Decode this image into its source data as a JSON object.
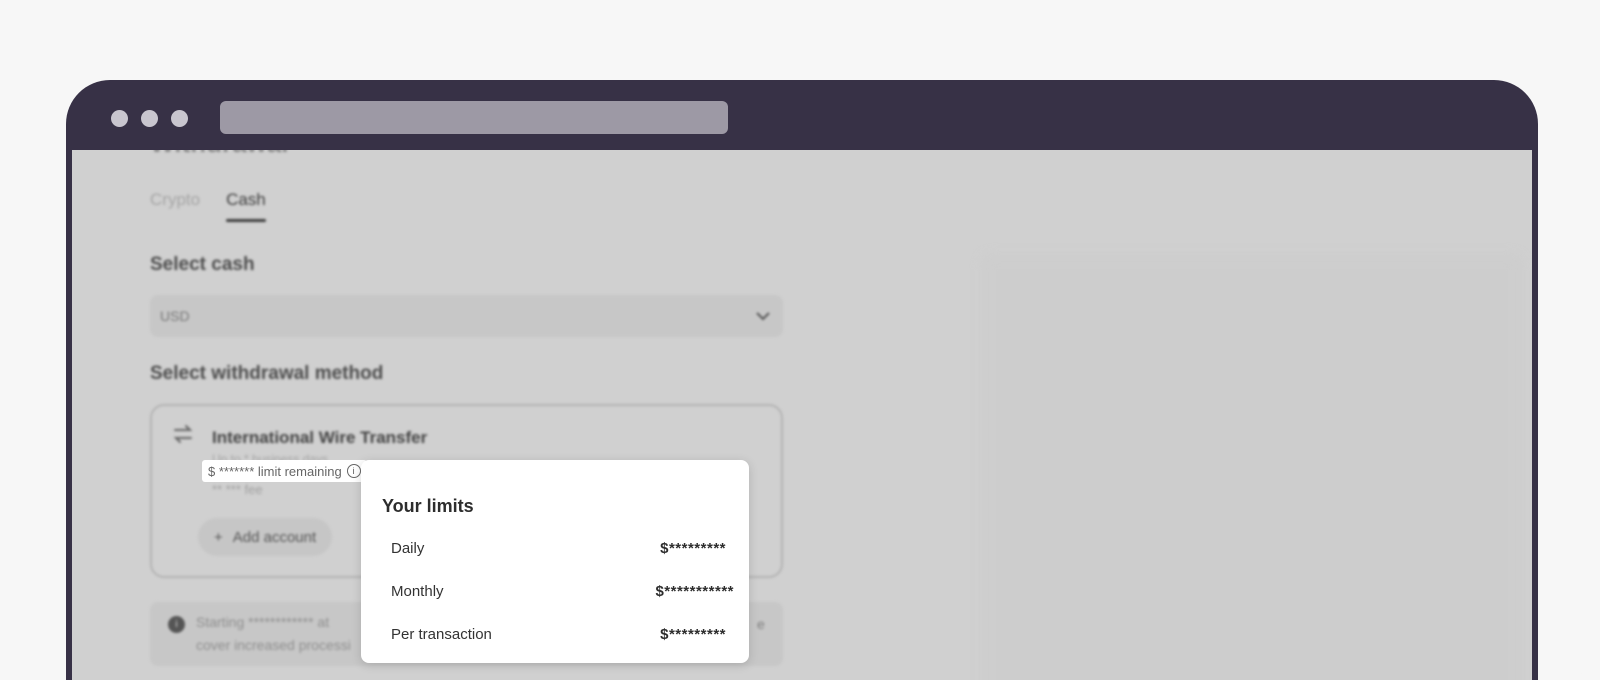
{
  "page": {
    "heading": "Withdrawal",
    "tabs": [
      {
        "label": "Crypto",
        "active": false
      },
      {
        "label": "Cash",
        "active": true
      }
    ],
    "select_cash": {
      "label": "Select cash",
      "value": "USD"
    },
    "method_section": {
      "label": "Select withdrawal method",
      "card": {
        "title": "International Wire Transfer",
        "subtitle": "Up to * business days",
        "fee": "** *** fee",
        "add_button": "Add account",
        "add_icon": "plus-icon",
        "method_icon": "transfer-arrows-icon"
      }
    },
    "info": {
      "number": "i",
      "line1": "Starting ************ at",
      "line2": "cover increased processi",
      "trail": "e"
    }
  },
  "limit_badge": {
    "text": "$ ******* limit remaining",
    "icon": "info-icon"
  },
  "limits_popover": {
    "title": "Your limits",
    "rows": [
      {
        "label": "Daily",
        "value": "$*********"
      },
      {
        "label": "Monthly",
        "value": "$***********"
      },
      {
        "label": "Per transaction",
        "value": "$*********"
      }
    ]
  },
  "colors": {
    "window_chrome": "#373146",
    "overlay": "#d0d0d0",
    "popover_bg": "#ffffff"
  }
}
